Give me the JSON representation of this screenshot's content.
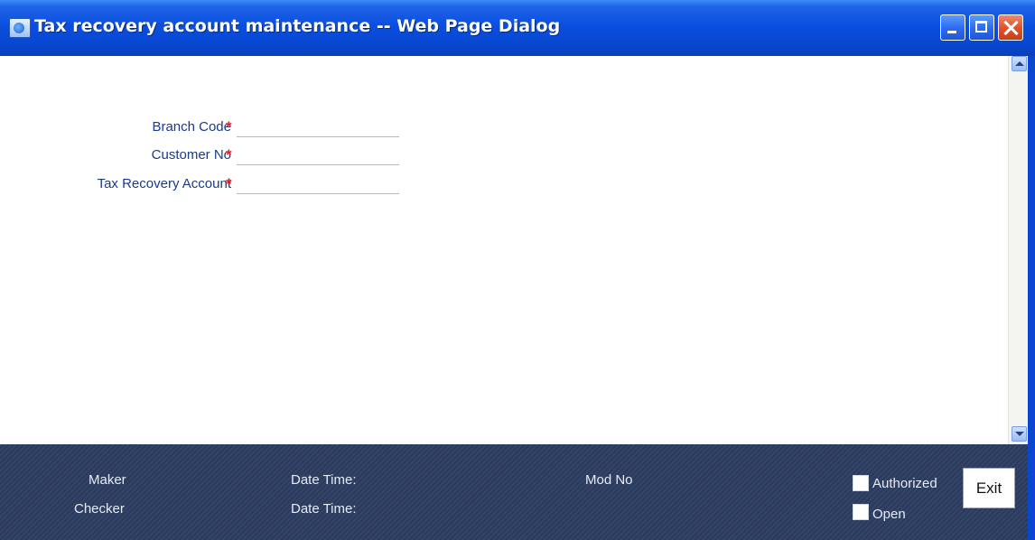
{
  "window": {
    "title": "Tax recovery account maintenance -- Web Page Dialog"
  },
  "form": {
    "fields": [
      {
        "label": "Branch Code",
        "required_mark": "*",
        "value": ""
      },
      {
        "label": "Customer No",
        "required_mark": "*",
        "value": ""
      },
      {
        "label": "Tax Recovery Account",
        "required_mark": "*",
        "value": ""
      }
    ]
  },
  "footer": {
    "maker_label": "Maker",
    "checker_label": "Checker",
    "maker_datetime_label": "Date Time:",
    "checker_datetime_label": "Date Time:",
    "mod_no_label": "Mod No",
    "authorized_label": "Authorized",
    "authorized_checked": false,
    "open_label": "Open",
    "open_checked": false,
    "exit_label": "Exit"
  },
  "icons": {
    "title": "ie-page-icon",
    "minimize": "minimize-icon",
    "maximize": "maximize-icon",
    "close": "close-icon",
    "scroll_up": "scroll-up-arrow-icon",
    "scroll_down": "scroll-down-arrow-icon"
  },
  "colors": {
    "titlebar": "#0a4fe0",
    "label_text": "#1a3a8a",
    "required": "#e02020",
    "footer_bg": "#2c3c60",
    "close_button": "#e0532c"
  }
}
